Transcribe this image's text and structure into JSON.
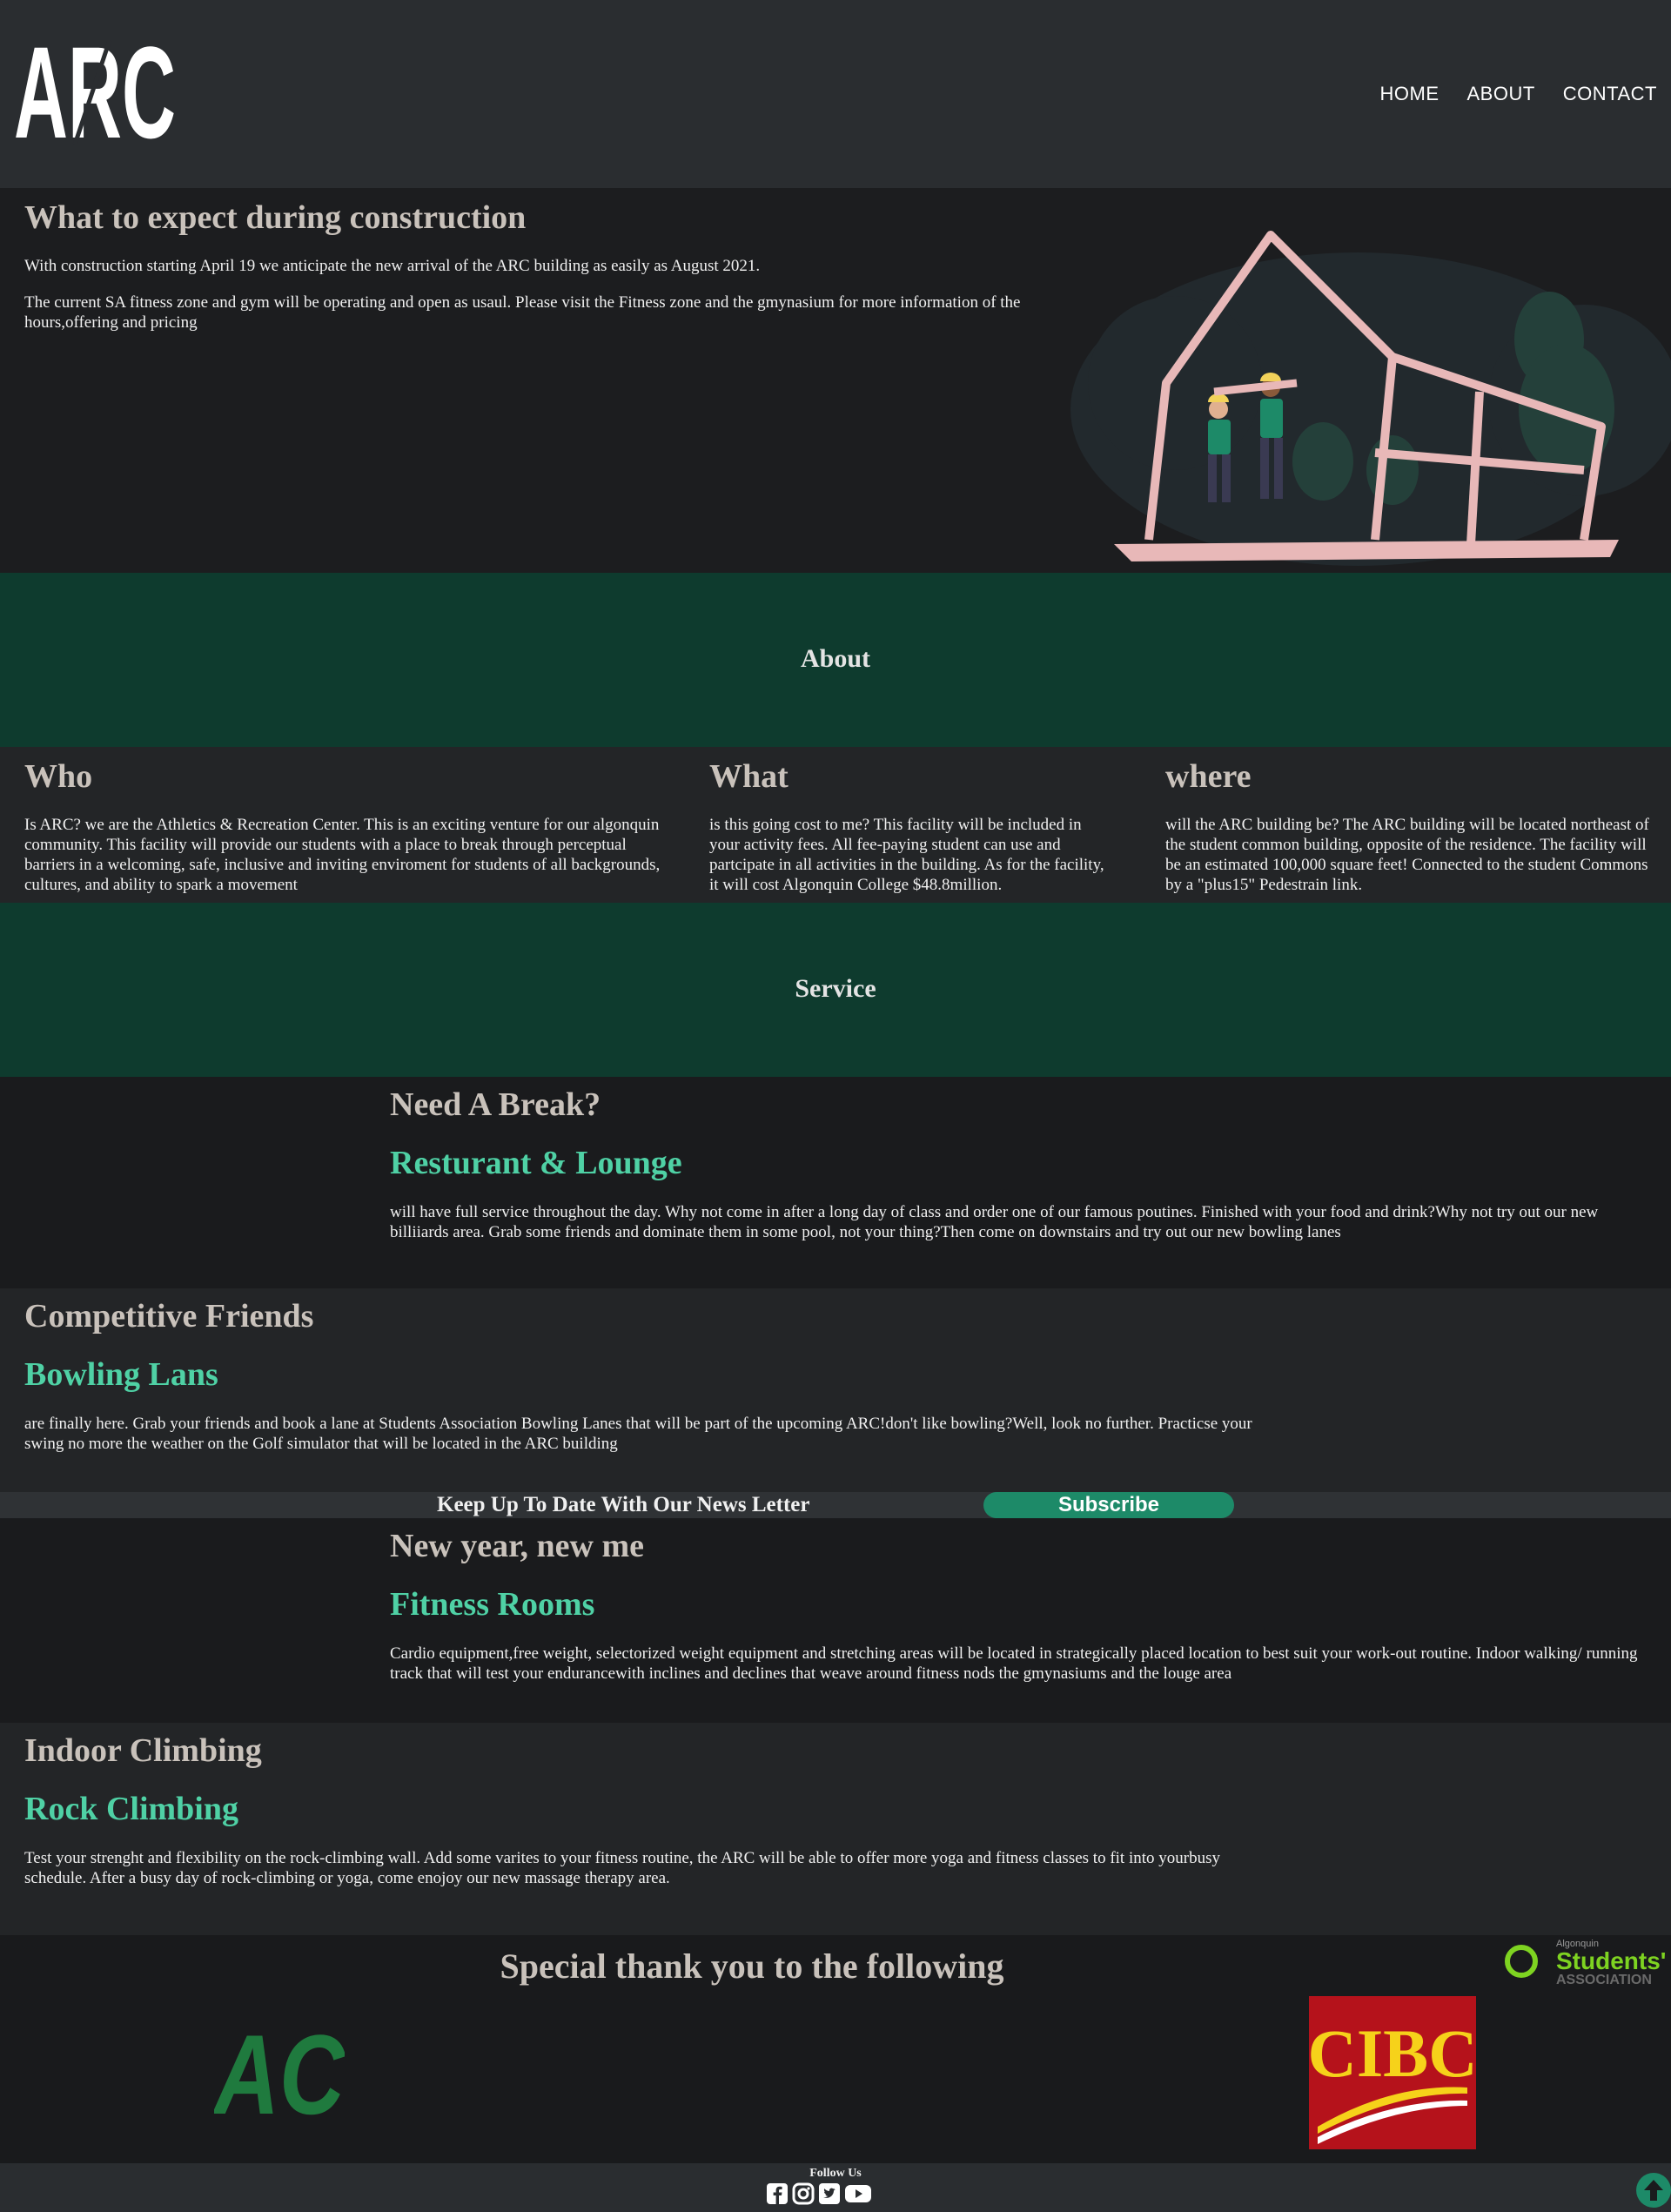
{
  "header": {
    "logo_text": "ARC",
    "nav": [
      "HOME",
      "ABOUT",
      "CONTACT"
    ]
  },
  "construction": {
    "title": "What to expect during construction",
    "p1": "With construction starting April 19 we anticipate the new arrival of the ARC building as easily as August 2021.",
    "p2": "The current SA fitness zone and gym will be operating and open as usaul. Please visit the Fitness zone and the gmynasium for more information of the hours,offering and pricing"
  },
  "about": {
    "heading": "About",
    "cols": [
      {
        "title": "Who",
        "text": "Is ARC? we are the Athletics & Recreation Center. This is an exciting venture for our algonquin community. This facility will provide our students with a place to break through perceptual barriers in a welcoming, safe, inclusive and inviting enviroment for students of all backgrounds, cultures, and ability to spark a movement"
      },
      {
        "title": "What",
        "text": "is this going cost to me? This facility will be included in your activity fees. All fee-paying student can use and partcipate in all activities in the building. As for the facility, it will cost Algonquin College $48.8million."
      },
      {
        "title": "where",
        "text": "will the ARC building be? The ARC building will be located northeast of the student common building, opposite of the residence. The facility will be an estimated 100,000 square feet! Connected to the student Commons by a \"plus15\" Pedestrain link."
      }
    ]
  },
  "service": {
    "heading": "Service",
    "items": [
      {
        "kicker": "Need A Break?",
        "title": "Resturant & Lounge",
        "text": "will have full service throughout the day. Why not come in after a long day of class and order one of our famous poutines. Finished with your food and drink?Why not try out our new billiiards area. Grab some friends and dominate them in some pool, not your thing?Then come on downstairs and try out our new bowling lanes"
      },
      {
        "kicker": "Competitive Friends",
        "title": "Bowling Lans",
        "text": "are finally here. Grab your friends and book a lane at Students Association Bowling Lanes that will be part of the upcoming ARC!don't like bowling?Well, look no further. Practicse your swing no more the weather on the Golf simulator that will be located in the ARC building"
      },
      {
        "kicker": "New year, new me",
        "title": "Fitness Rooms",
        "text": "Cardio equipment,free weight, selectorized weight equipment and stretching areas will be located in strategically placed location to best suit your work-out routine. Indoor walking/ running track that will test your endurancewith inclines and declines that weave around fitness nods the gmynasiums and the louge area"
      },
      {
        "kicker": "Indoor Climbing",
        "title": "Rock Climbing",
        "text": "Test your strenght and flexibility on the rock-climbing wall. Add some varites to your fitness routine, the ARC will be able to offer more yoga and fitness classes to fit into yourbusy schedule. After a busy day of rock-climbing or yoga, come enojoy our new massage therapy area."
      }
    ]
  },
  "newsletter": {
    "label": "Keep Up To Date With Our News Letter",
    "button": "Subscribe"
  },
  "sponsors": {
    "heading": "Special thank you to the following",
    "logos": {
      "ac": "AC",
      "cibc": "CIBC",
      "sa_small": "Algonquin",
      "sa_main": "Students'",
      "sa_sub": "ASSOCIATION"
    }
  },
  "footer": {
    "follow": "Follow Us",
    "icons": [
      "facebook-icon",
      "instagram-icon",
      "twitter-icon",
      "youtube-icon"
    ]
  },
  "colors": {
    "accent": "#4fd1a5",
    "band": "#0e3b2e",
    "button": "#1d8a68"
  }
}
